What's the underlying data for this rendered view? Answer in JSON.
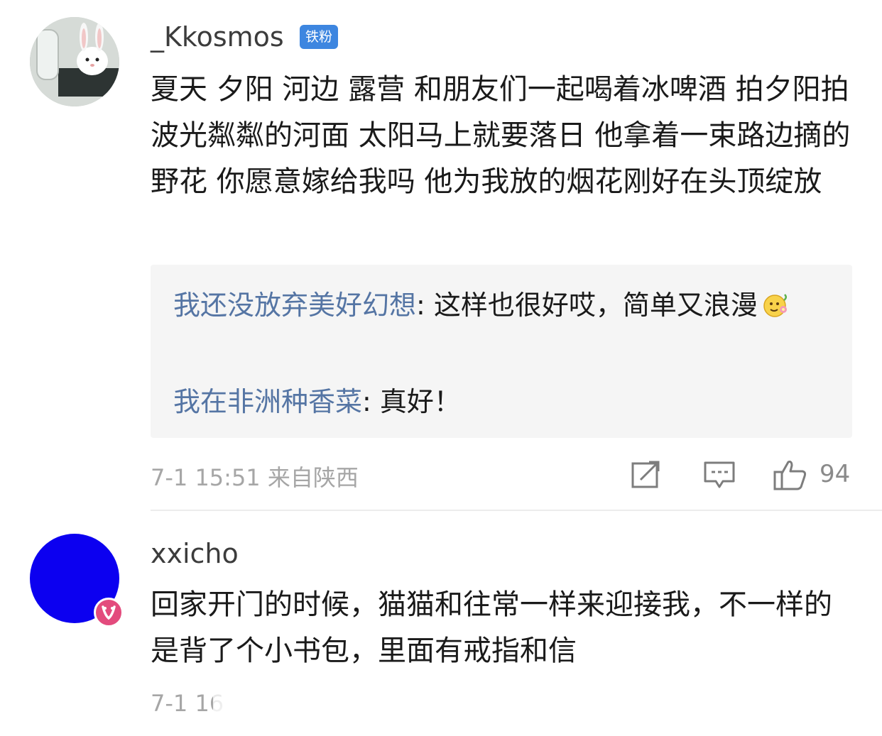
{
  "comments": [
    {
      "username": "_Kkosmos",
      "badge": "铁粉",
      "text": "夏天 夕阳 河边 露营  和朋友们一起喝着冰啤酒 拍夕阳拍波光粼粼的河面  太阳马上就要落日 他拿着一束路边摘的野花  你愿意嫁给我吗 他为我放的烟花刚好在头顶绽放",
      "replies": [
        {
          "name": "我还没放弃美好幻想",
          "text": ": 这样也很好哎，简单又浪漫"
        },
        {
          "name": "我在非洲种香菜",
          "text": ": 真好！"
        }
      ],
      "time": "7-1 15:51",
      "location": "来自陕西",
      "likes": "94"
    },
    {
      "username": "xxicho",
      "text": "回家开门的时候，猫猫和往常一样来迎接我，不一样的是背了个小书包，里面有戒指和信",
      "time": "7-1 16"
    }
  ],
  "icons": {
    "share": "share-icon",
    "comment": "comment-icon",
    "like": "like-icon",
    "verified": "verified-badge-icon"
  },
  "colors": {
    "reply_name": "#5575a4",
    "fan_badge": "#3d86e0",
    "avatar_blue": "#0c00f0",
    "verified_badge": "#e34b7d"
  }
}
